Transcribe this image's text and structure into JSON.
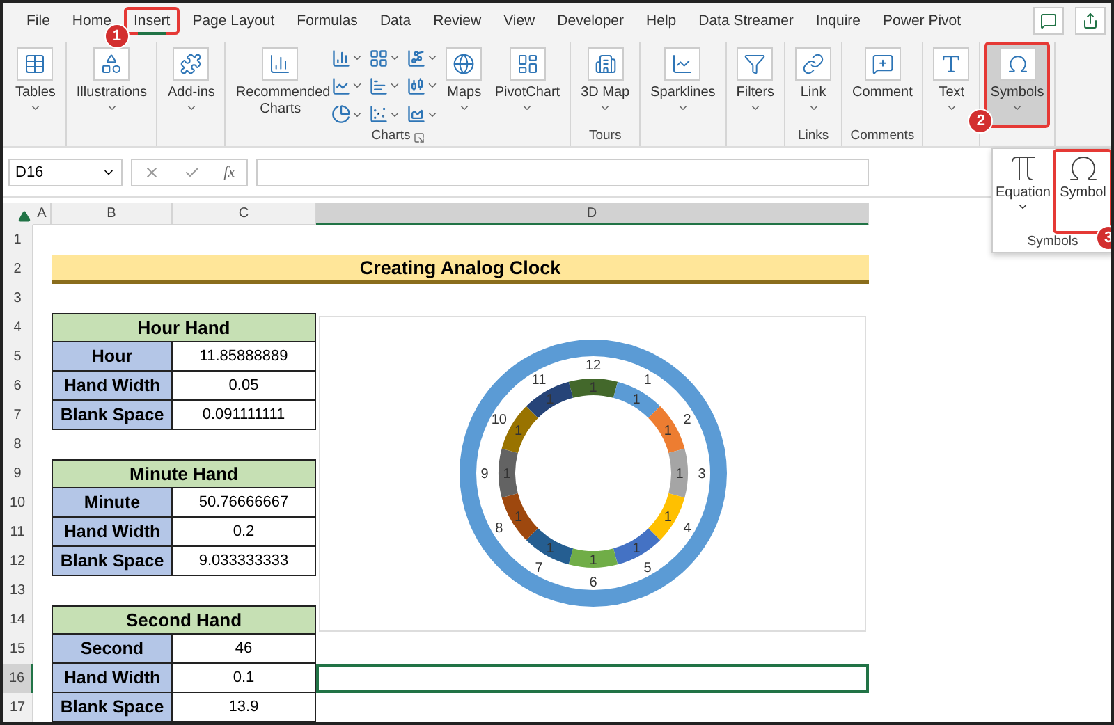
{
  "menu_tabs": [
    {
      "label": "File",
      "selected": false
    },
    {
      "label": "Home",
      "selected": false
    },
    {
      "label": "Insert",
      "selected": true,
      "callout": "1"
    },
    {
      "label": "Page Layout",
      "selected": false
    },
    {
      "label": "Formulas",
      "selected": false
    },
    {
      "label": "Data",
      "selected": false
    },
    {
      "label": "Review",
      "selected": false
    },
    {
      "label": "View",
      "selected": false
    },
    {
      "label": "Developer",
      "selected": false
    },
    {
      "label": "Help",
      "selected": false
    },
    {
      "label": "Data Streamer",
      "selected": false
    },
    {
      "label": "Inquire",
      "selected": false
    },
    {
      "label": "Power Pivot",
      "selected": false
    }
  ],
  "ribbon": {
    "groups": [
      {
        "buttons": [
          {
            "kind": "large",
            "label": "Tables",
            "caret": true
          }
        ]
      },
      {
        "buttons": [
          {
            "kind": "large",
            "label": "Illustrations",
            "caret": true
          }
        ]
      },
      {
        "buttons": [
          {
            "kind": "large",
            "label": "Add-ins",
            "caret": true
          }
        ]
      },
      {
        "label": "Charts",
        "launcher": true,
        "buttons": [
          {
            "kind": "large",
            "label": "Recommended Charts",
            "caret": false
          },
          {
            "kind": "grid"
          },
          {
            "kind": "large",
            "label": "Maps",
            "caret": true
          },
          {
            "kind": "large",
            "label": "PivotChart",
            "caret": true
          }
        ]
      },
      {
        "label": "Tours",
        "buttons": [
          {
            "kind": "large",
            "label": "3D Map",
            "caret": true
          }
        ]
      },
      {
        "buttons": [
          {
            "kind": "large",
            "label": "Sparklines",
            "caret": true
          }
        ]
      },
      {
        "buttons": [
          {
            "kind": "large",
            "label": "Filters",
            "caret": true
          }
        ]
      },
      {
        "label": "Links",
        "buttons": [
          {
            "kind": "large",
            "label": "Link",
            "caret": true
          }
        ]
      },
      {
        "label": "Comments",
        "buttons": [
          {
            "kind": "large",
            "label": "Comment",
            "caret": false
          }
        ]
      },
      {
        "buttons": [
          {
            "kind": "large",
            "label": "Text",
            "caret": true
          }
        ]
      },
      {
        "buttons": [
          {
            "kind": "large",
            "label": "Symbols",
            "caret": true,
            "selected": true,
            "callout": "2"
          }
        ]
      }
    ]
  },
  "symbols_menu": {
    "label": "Symbols",
    "items": [
      {
        "label": "Equation",
        "caret": true
      },
      {
        "label": "Symbol",
        "caret": false,
        "callout": "3"
      }
    ]
  },
  "formula_bar": {
    "name_box": "D16",
    "function_button": "fx"
  },
  "sheet": {
    "columns": [
      {
        "label": "A",
        "selected": false
      },
      {
        "label": "B",
        "selected": false
      },
      {
        "label": "C",
        "selected": false
      },
      {
        "label": "D",
        "selected": true
      }
    ],
    "rows": [
      {
        "label": "1",
        "selected": false
      },
      {
        "label": "2",
        "selected": false
      },
      {
        "label": "3",
        "selected": false
      },
      {
        "label": "4",
        "selected": false
      },
      {
        "label": "5",
        "selected": false
      },
      {
        "label": "6",
        "selected": false
      },
      {
        "label": "7",
        "selected": false
      },
      {
        "label": "8",
        "selected": false
      },
      {
        "label": "9",
        "selected": false
      },
      {
        "label": "10",
        "selected": false
      },
      {
        "label": "11",
        "selected": false
      },
      {
        "label": "12",
        "selected": false
      },
      {
        "label": "13",
        "selected": false
      },
      {
        "label": "14",
        "selected": false
      },
      {
        "label": "15",
        "selected": false
      },
      {
        "label": "16",
        "selected": true
      },
      {
        "label": "17",
        "selected": false
      }
    ],
    "title": "Creating Analog Clock",
    "tables": [
      {
        "header": "Hour Hand",
        "rows": [
          {
            "label": "Hour",
            "value": "11.85888889"
          },
          {
            "label": "Hand Width",
            "value": "0.05"
          },
          {
            "label": "Blank Space",
            "value": "0.091111111"
          }
        ]
      },
      {
        "header": "Minute Hand",
        "rows": [
          {
            "label": "Minute",
            "value": "50.76666667"
          },
          {
            "label": "Hand Width",
            "value": "0.2"
          },
          {
            "label": "Blank Space",
            "value": "9.033333333"
          }
        ]
      },
      {
        "header": "Second Hand",
        "rows": [
          {
            "label": "Second",
            "value": "46"
          },
          {
            "label": "Hand Width",
            "value": "0.1"
          },
          {
            "label": "Blank Space",
            "value": "13.9"
          }
        ]
      }
    ],
    "chart_data": {
      "type": "donut",
      "categories": [
        "12",
        "1",
        "2",
        "3",
        "4",
        "5",
        "6",
        "7",
        "8",
        "9",
        "10",
        "11"
      ],
      "series": [
        {
          "values": [
            1,
            1,
            1,
            1,
            1,
            1,
            1,
            1,
            1,
            1,
            1,
            1
          ]
        }
      ],
      "data_labels": true
    }
  }
}
